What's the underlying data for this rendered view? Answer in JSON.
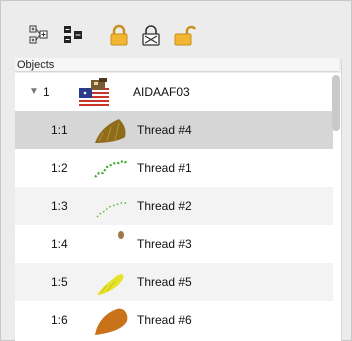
{
  "toolbar": {
    "buttons": [
      {
        "icon": "expand-tree-icon"
      },
      {
        "icon": "collapse-tree-icon"
      },
      {
        "icon": "lock-icon"
      },
      {
        "icon": "hide-icon"
      },
      {
        "icon": "unlock-icon"
      }
    ]
  },
  "objects": {
    "header": "Objects",
    "top": {
      "index": "1",
      "name": "AIDAAF03"
    },
    "items": [
      {
        "index": "1:1",
        "name": "Thread #4",
        "color": "#8f6b1c"
      },
      {
        "index": "1:2",
        "name": "Thread #1",
        "color": "#3caa2a"
      },
      {
        "index": "1:3",
        "name": "Thread #2",
        "color": "#54b835"
      },
      {
        "index": "1:4",
        "name": "Thread #3",
        "color": "#a07848"
      },
      {
        "index": "1:5",
        "name": "Thread #5",
        "color": "#e6e22a"
      },
      {
        "index": "1:6",
        "name": "Thread #6",
        "color": "#c8721a"
      }
    ]
  }
}
